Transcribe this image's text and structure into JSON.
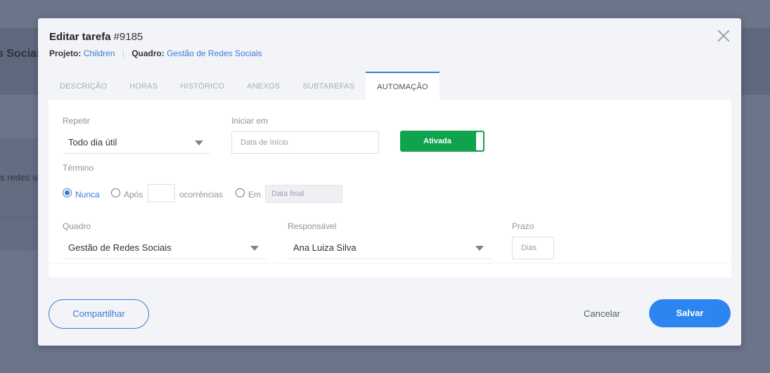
{
  "background": {
    "title": "s Sociais",
    "text": "s redes so"
  },
  "modal": {
    "title": "Editar tarefa",
    "task_id": "#9185",
    "project_label": "Projeto:",
    "project_value": "Children",
    "board_label": "Quadro:",
    "board_value": "Gestão de Redes Sociais"
  },
  "tabs": [
    {
      "label": "DESCRIÇÃO",
      "active": false
    },
    {
      "label": "HORAS",
      "active": false
    },
    {
      "label": "HISTÓRICO",
      "active": false
    },
    {
      "label": "ANEXOS",
      "active": false
    },
    {
      "label": "SUBTAREFAS",
      "active": false
    },
    {
      "label": "AUTOMAÇÃO",
      "active": true
    }
  ],
  "automation": {
    "repeat_label": "Repetir",
    "repeat_value": "Todo dia útil",
    "start_label": "Iniciar em",
    "start_placeholder": "Data de Início",
    "toggle_label": "Ativada",
    "end_label": "Término",
    "end_options": {
      "never": "Nunca",
      "after": "Após",
      "occurrences": "ocorrências",
      "on": "Em",
      "end_date_placeholder": "Data final"
    },
    "end_selected": "never",
    "board_label": "Quadro",
    "board_value": "Gestão de Redes Sociais",
    "responsible_label": "Responsável",
    "responsible_value": "Ana Luiza Silva",
    "deadline_label": "Prazo",
    "deadline_placeholder": "Dias"
  },
  "footer": {
    "share_label": "Compartilhar",
    "cancel_label": "Cancelar",
    "save_label": "Salvar"
  },
  "colors": {
    "accent": "#3a7bd5",
    "save_button": "#2d85f1",
    "toggle_on": "#0fa34d",
    "overlay": "#6b7488"
  }
}
